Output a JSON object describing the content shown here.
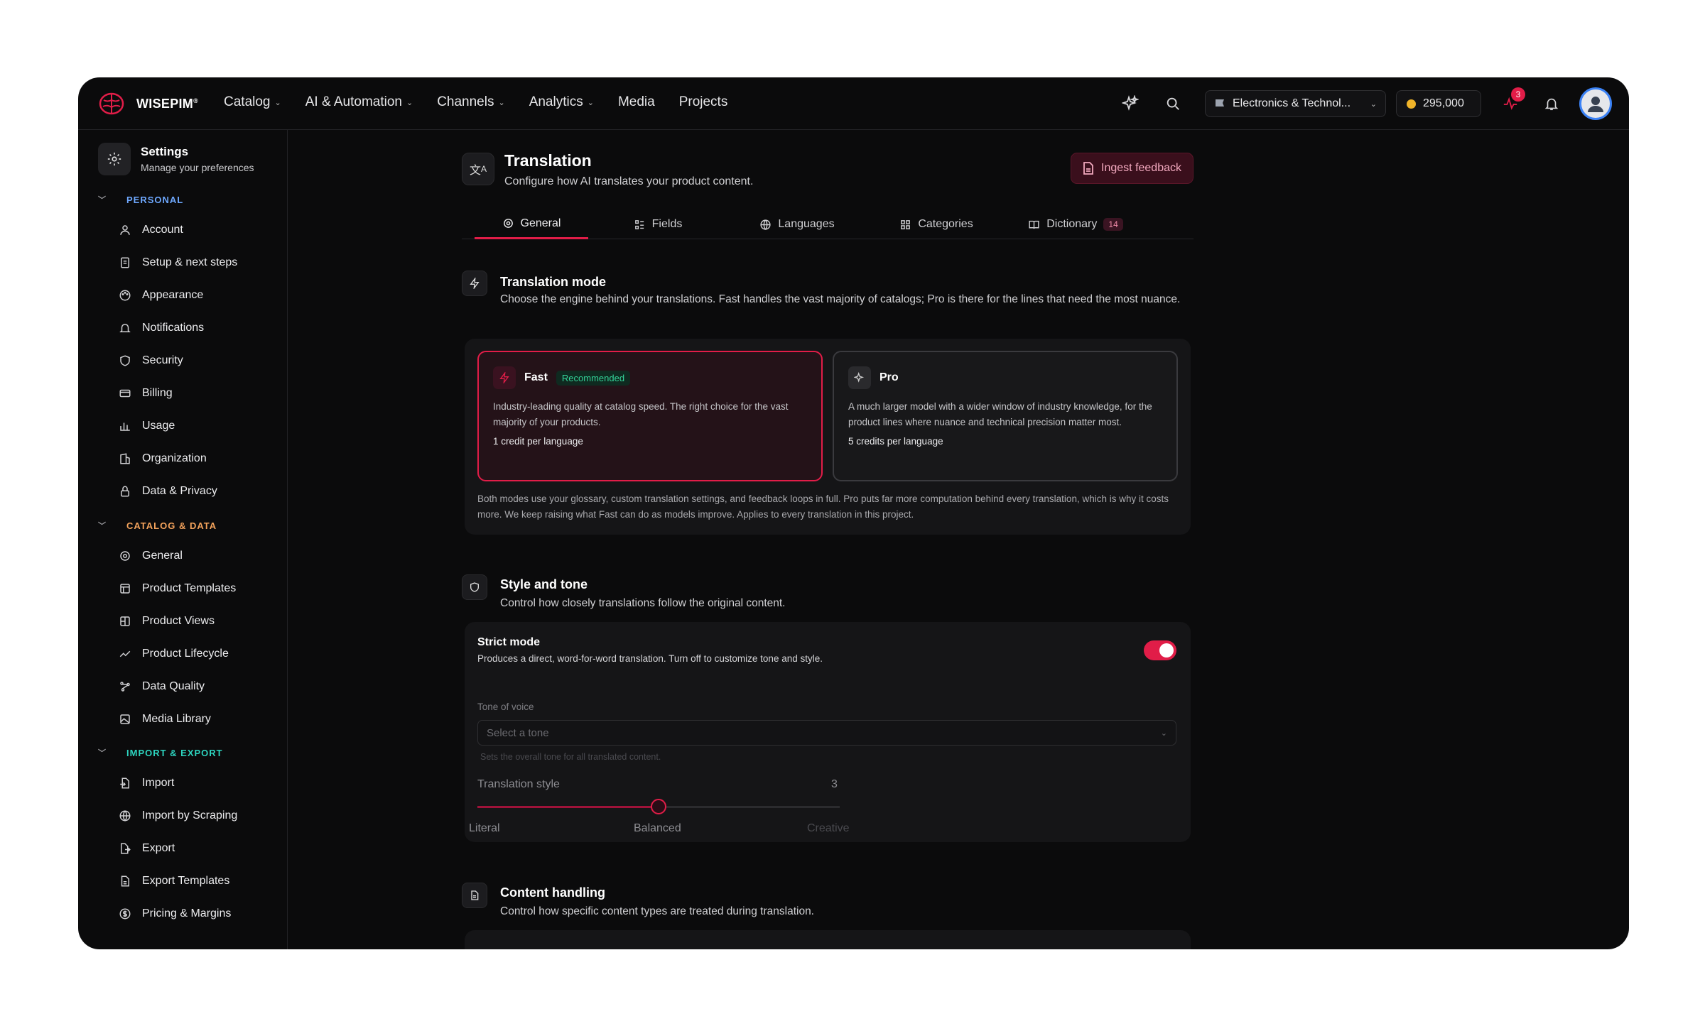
{
  "brand": {
    "name": "WISEPIM",
    "mark": "®"
  },
  "nav": {
    "items": [
      {
        "label": "Catalog",
        "dropdown": true
      },
      {
        "label": "AI & Automation",
        "dropdown": true
      },
      {
        "label": "Channels",
        "dropdown": true
      },
      {
        "label": "Analytics",
        "dropdown": true
      },
      {
        "label": "Media",
        "dropdown": false
      },
      {
        "label": "Projects",
        "dropdown": false
      }
    ]
  },
  "topright": {
    "workspace": "Electronics & Technol...",
    "credits": "295,000",
    "alert_count": "3"
  },
  "sidebar": {
    "title": "Settings",
    "subtitle": "Manage your preferences",
    "personal_label": "PERSONAL",
    "personal": [
      "Account",
      "Setup & next steps",
      "Appearance",
      "Notifications",
      "Security",
      "Billing",
      "Usage",
      "Organization",
      "Data & Privacy"
    ],
    "catalog_label": "CATALOG & DATA",
    "catalog": [
      "General",
      "Product Templates",
      "Product Views",
      "Product Lifecycle",
      "Data Quality",
      "Media Library"
    ],
    "import_label": "IMPORT & EXPORT",
    "import": [
      "Import",
      "Import by Scraping",
      "Export",
      "Export Templates",
      "Pricing & Margins"
    ]
  },
  "page": {
    "title": "Translation",
    "subtitle": "Configure how AI translates your product content.",
    "ingest_label": "Ingest feedback",
    "tabs": [
      {
        "label": "General"
      },
      {
        "label": "Fields"
      },
      {
        "label": "Languages"
      },
      {
        "label": "Categories"
      },
      {
        "label": "Dictionary",
        "badge": "14"
      }
    ]
  },
  "mode": {
    "title": "Translation mode",
    "desc": "Choose the engine behind your translations. Fast handles the vast majority of catalogs; Pro is there for the lines that need the most nuance.",
    "fast": {
      "name": "Fast",
      "badge": "Recommended",
      "desc": "Industry-leading quality at catalog speed. The right choice for the vast majority of your products.",
      "cost": "1 credit per language"
    },
    "pro": {
      "name": "Pro",
      "desc": "A much larger model with a wider window of industry knowledge, for the product lines where nuance and technical precision matter most.",
      "cost": "5 credits per language"
    },
    "note": "Both modes use your glossary, custom translation settings, and feedback loops in full. Pro puts far more computation behind every translation, which is why it costs more. We keep raising what Fast can do as models improve. Applies to every translation in this project."
  },
  "style": {
    "title": "Style and tone",
    "desc": "Control how closely translations follow the original content.",
    "strict_label": "Strict mode",
    "strict_desc": "Produces a direct, word-for-word translation. Turn off to customize tone and style.",
    "strict_on": true,
    "tone_label": "Tone of voice",
    "tone_placeholder": "Select a tone",
    "tone_help": "Sets the overall tone for all translated content.",
    "slider_label": "Translation style",
    "slider_value": "3",
    "slider_value_num": 3,
    "slider_min": 1,
    "slider_max": 5,
    "labels": [
      "Literal",
      "Balanced",
      "Creative"
    ]
  },
  "content": {
    "title": "Content handling",
    "desc": "Control how specific content types are treated during translation."
  },
  "colors": {
    "accent": "#e11d48",
    "background": "#0b0b0c",
    "panel": "#151517",
    "success": "#34d399"
  }
}
